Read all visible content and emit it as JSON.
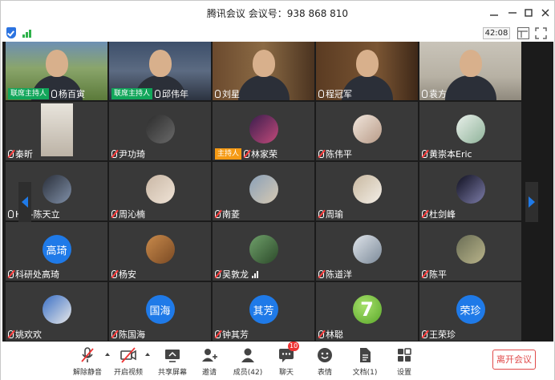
{
  "window": {
    "title": "腾讯会议 会议号：938 868 810",
    "controls": [
      "minimize-icon",
      "restore-icon",
      "maximize-icon",
      "close-icon"
    ]
  },
  "infobar": {
    "timer": "42:08",
    "icons": [
      "security-shield-icon",
      "network-signal-icon",
      "view-layout-icon",
      "fullscreen-icon"
    ]
  },
  "colors": {
    "grid_bg": "#1b1b1b",
    "tile_bg": "#393939",
    "host_green": "#11a65a",
    "host_orange": "#f59a14",
    "arrow_blue": "#1f7ae8",
    "leave_red": "#e04a4a"
  },
  "participants": [
    {
      "name": "杨百寅",
      "tag": "联席主持人",
      "tag_color": "green",
      "mic": "on",
      "media": "video"
    },
    {
      "name": "邱伟年",
      "tag": "联席主持人",
      "tag_color": "green",
      "mic": "on",
      "media": "video"
    },
    {
      "name": "刘星",
      "mic": "on",
      "media": "video"
    },
    {
      "name": "程冠军",
      "mic": "on",
      "media": "video"
    },
    {
      "name": "袁方",
      "mic": "on",
      "media": "video"
    },
    {
      "name": "秦昕",
      "mic": "muted",
      "media": "video-small"
    },
    {
      "name": "尹功琦",
      "mic": "muted",
      "media": "avatar"
    },
    {
      "name": "林家荣",
      "tag": "主持人",
      "tag_color": "orange",
      "mic": "muted",
      "media": "avatar"
    },
    {
      "name": "陈伟平",
      "mic": "muted",
      "media": "avatar"
    },
    {
      "name": "黄崇本Eric",
      "mic": "muted",
      "media": "avatar"
    },
    {
      "name": "HW-陈天立",
      "mic": "on",
      "media": "avatar"
    },
    {
      "name": "周沁楠",
      "mic": "muted",
      "media": "avatar"
    },
    {
      "name": "南菱",
      "mic": "muted",
      "media": "avatar"
    },
    {
      "name": "周瑜",
      "mic": "muted",
      "media": "avatar"
    },
    {
      "name": "杜剑峰",
      "mic": "muted",
      "media": "avatar"
    },
    {
      "name": "科研处高琦",
      "mic": "muted",
      "media": "avatar-text",
      "avatar_text": "高琦"
    },
    {
      "name": "杨安",
      "mic": "muted",
      "media": "avatar"
    },
    {
      "name": "吴敦龙",
      "mic": "muted",
      "media": "avatar",
      "speaking": true
    },
    {
      "name": "陈道洋",
      "mic": "muted",
      "media": "avatar"
    },
    {
      "name": "陈平",
      "mic": "muted",
      "media": "avatar"
    },
    {
      "name": "姚欢欢",
      "mic": "muted",
      "media": "avatar"
    },
    {
      "name": "陈国海",
      "mic": "muted",
      "media": "avatar-text",
      "avatar_text": "国海"
    },
    {
      "name": "钟其芳",
      "mic": "muted",
      "media": "avatar-text",
      "avatar_text": "其芳"
    },
    {
      "name": "林聪",
      "mic": "muted",
      "media": "avatar-seven",
      "avatar_text": "7"
    },
    {
      "name": "王荣珍",
      "mic": "muted",
      "media": "avatar-text",
      "avatar_text": "荣珍"
    }
  ],
  "toolbar": {
    "unmute": "解除静音",
    "start_video": "开启视频",
    "share_screen": "共享屏幕",
    "invite": "邀请",
    "members": "成员(42)",
    "chat": "聊天",
    "chat_badge": "10",
    "reactions": "表情",
    "documents": "文档(1)",
    "settings": "设置",
    "leave": "离开会议"
  }
}
